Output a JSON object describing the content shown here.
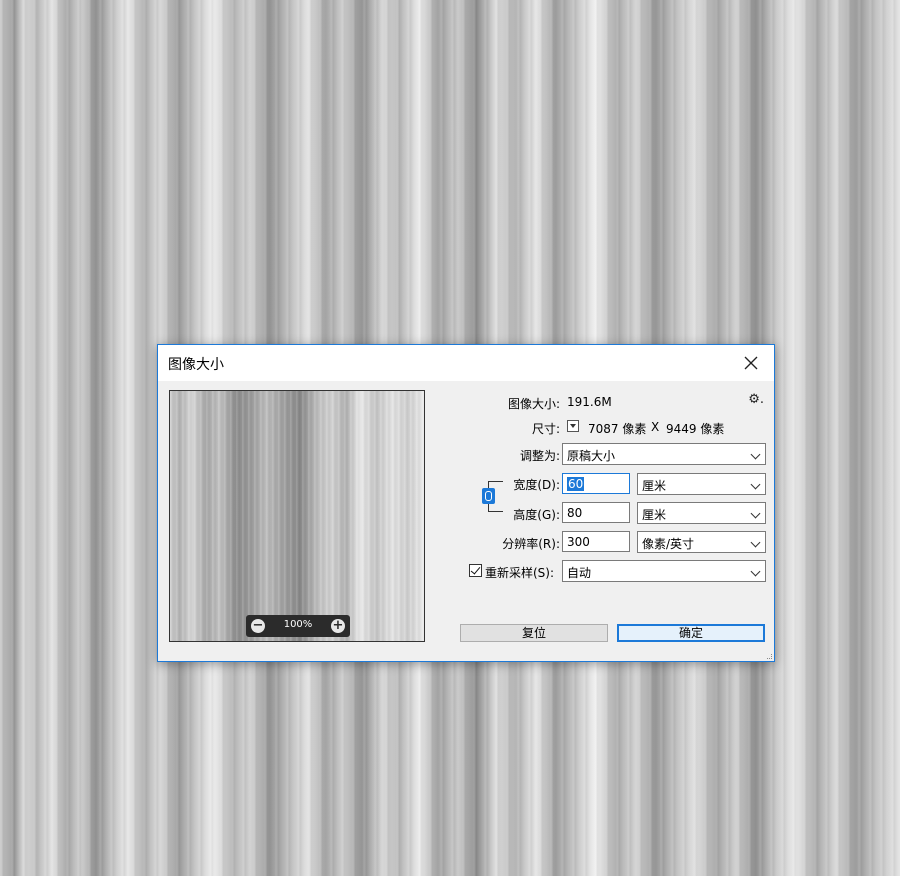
{
  "window": {
    "title": "图像大小"
  },
  "preview": {
    "zoom": "100%"
  },
  "info": {
    "size_label": "图像大小:",
    "size_value": "191.6M",
    "dims_label": "尺寸:",
    "dims_width": "7087 像素",
    "dims_x": "X",
    "dims_height": "9449 像素"
  },
  "fit_to": {
    "label": "调整为:",
    "value": "原稿大小"
  },
  "width": {
    "label": "宽度(D):",
    "value": "60",
    "unit": "厘米"
  },
  "height": {
    "label": "高度(G):",
    "value": "80",
    "unit": "厘米"
  },
  "resolution": {
    "label": "分辨率(R):",
    "value": "300",
    "unit": "像素/英寸"
  },
  "resample": {
    "label": "重新采样(S):",
    "checked": true,
    "value": "自动"
  },
  "buttons": {
    "reset": "复位",
    "ok": "确定"
  },
  "colors": {
    "accent": "#1c79d8",
    "dialog_bg": "#f0f0f0"
  }
}
